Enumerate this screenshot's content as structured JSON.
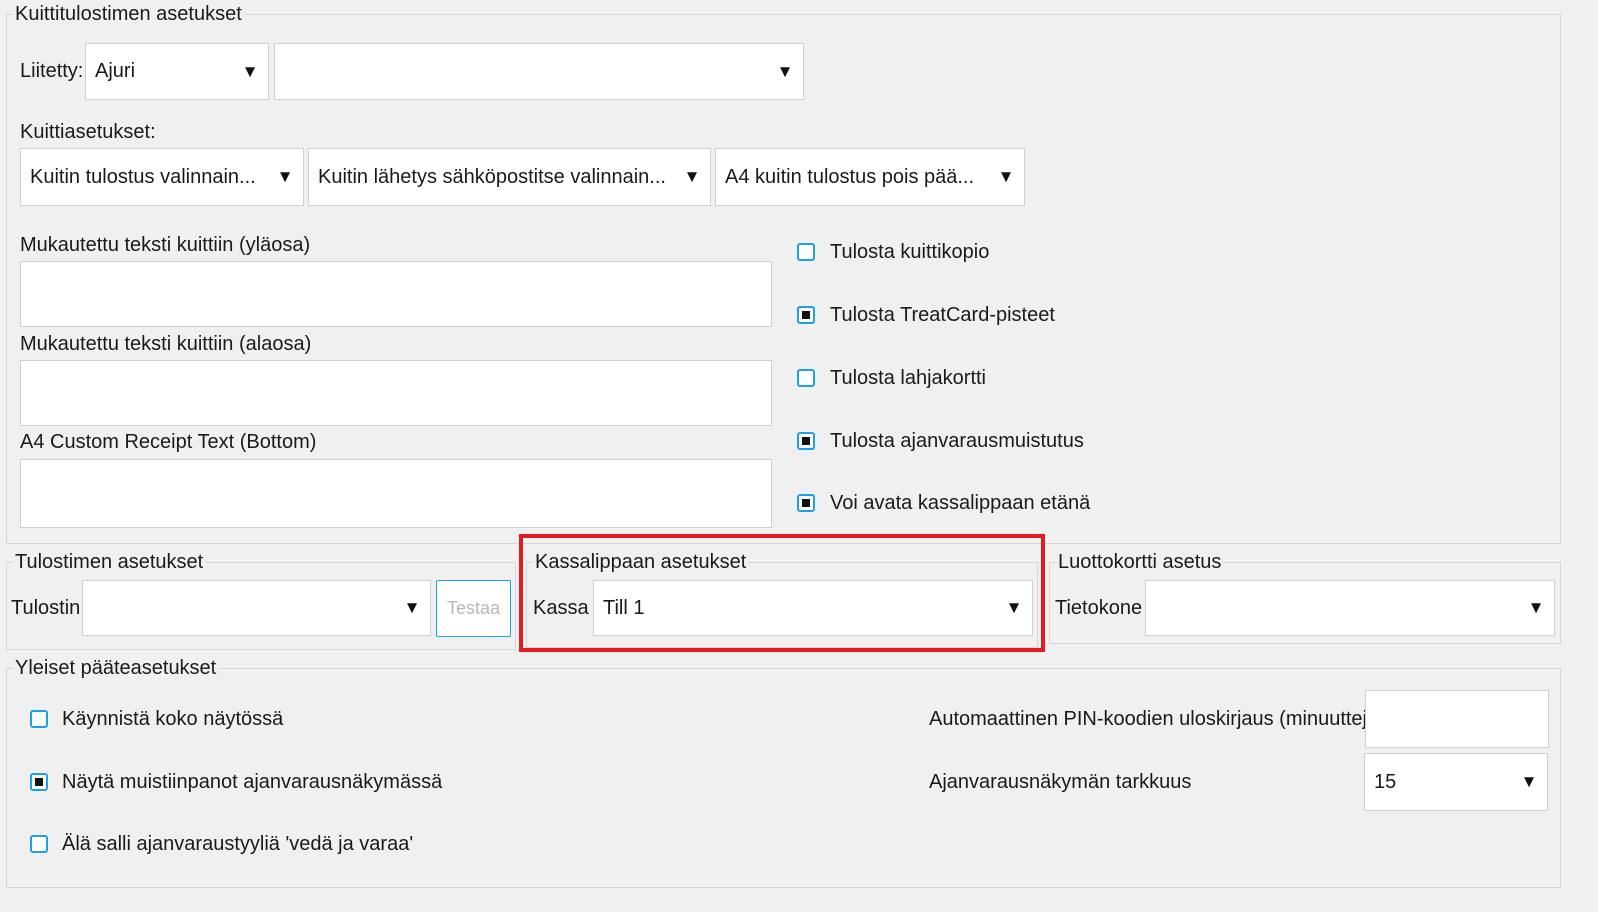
{
  "receipt_printer": {
    "title": "Kuittitulostimen asetukset",
    "connected_label": "Liitetty:",
    "connection_value": "Ajuri",
    "connection_detail_value": "",
    "receipt_settings_label": "Kuittiasetukset:",
    "receipt_print_option": "Kuitin tulostus valinnain...",
    "receipt_email_option": "Kuitin lähetys sähköpostitse valinnain...",
    "a4_receipt_option": "A4 kuitin tulostus pois pää...",
    "custom_top_label": "Mukautettu teksti kuittiin (yläosa)",
    "custom_bottom_label": "Mukautettu teksti kuittiin (alaosa)",
    "a4_custom_label": "A4 Custom Receipt Text (Bottom)",
    "checkboxes": [
      {
        "label": "Tulosta kuittikopio",
        "checked": false
      },
      {
        "label": "Tulosta TreatCard-pisteet",
        "checked": true
      },
      {
        "label": "Tulosta lahjakortti",
        "checked": false
      },
      {
        "label": "Tulosta ajanvarausmuistutus",
        "checked": true
      },
      {
        "label": "Voi avata kassalippaan etänä",
        "checked": true
      }
    ]
  },
  "printer_settings": {
    "title": "Tulostimen asetukset",
    "printer_label": "Tulostin",
    "printer_value": "",
    "test_button": "Testaa"
  },
  "cash_drawer": {
    "title": "Kassalippaan asetukset",
    "till_label": "Kassa",
    "till_value": "Till 1"
  },
  "credit_card": {
    "title": "Luottokortti asetus",
    "computer_label": "Tietokone",
    "computer_value": ""
  },
  "general": {
    "title": "Yleiset pääteasetukset",
    "checkboxes": [
      {
        "label": "Käynnistä koko näytössä",
        "checked": false
      },
      {
        "label": "Näytä muistiinpanot ajanvarausnäkymässä",
        "checked": true
      },
      {
        "label": "Älä salli ajanvaraustyyliä 'vedä ja varaa'",
        "checked": false
      }
    ],
    "pin_logout_label": "Automaattinen PIN-koodien uloskirjaus (minuutteja)",
    "pin_logout_value": "",
    "granularity_label": "Ajanvarausnäkymän tarkkuus",
    "granularity_value": "15"
  },
  "colors": {
    "highlight": "#e11b22",
    "checkbox_border": "#1ca0e6"
  },
  "icons": {
    "dropdown": "▼"
  }
}
